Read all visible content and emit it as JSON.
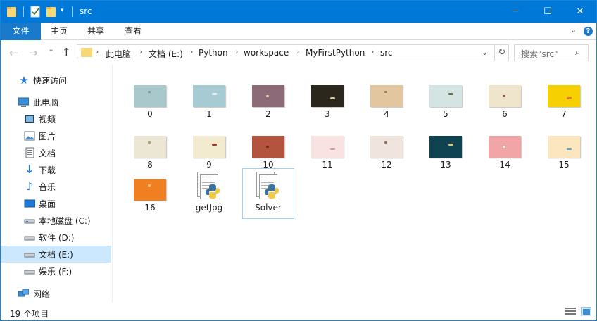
{
  "window": {
    "title": "src",
    "accent": "#0078d7",
    "controls": {
      "minimize": "─",
      "maximize": "☐",
      "close": "✕"
    }
  },
  "ribbon": {
    "tabs": [
      "文件",
      "主页",
      "共享",
      "查看"
    ],
    "collapse_icon": "chevron-down-icon",
    "help_label": "?"
  },
  "address": {
    "back": "←",
    "forward": "→",
    "recent": "⌄",
    "up": "↑",
    "crumbs": [
      "此电脑",
      "文档 (E:)",
      "Python",
      "workspace",
      "MyFirstPython",
      "src"
    ],
    "separator": "›",
    "dropdown": "⌄",
    "refresh": "↻"
  },
  "search": {
    "placeholder": "搜索\"src\"",
    "icon": "⌕"
  },
  "nav": {
    "quick_access": "快速访问",
    "this_pc": "此电脑",
    "items": [
      {
        "label": "视频",
        "icon": "video-icon"
      },
      {
        "label": "图片",
        "icon": "picture-icon"
      },
      {
        "label": "文档",
        "icon": "document-icon"
      },
      {
        "label": "下载",
        "icon": "download-icon"
      },
      {
        "label": "音乐",
        "icon": "music-icon"
      },
      {
        "label": "桌面",
        "icon": "desktop-icon"
      },
      {
        "label": "本地磁盘 (C:)",
        "icon": "drive-icon"
      },
      {
        "label": "软件 (D:)",
        "icon": "drive-icon"
      },
      {
        "label": "文档 (E:)",
        "icon": "drive-icon"
      },
      {
        "label": "娱乐 (F:)",
        "icon": "drive-icon"
      }
    ],
    "network": "网络",
    "selected": "文档 (E:)"
  },
  "files": [
    {
      "name": "0",
      "bg": "#a9c8cb",
      "dot": "#6f8f93"
    },
    {
      "name": "1",
      "bg": "#a7cbd3",
      "dot": "#f2f2f2"
    },
    {
      "name": "2",
      "bg": "#8d6a78",
      "dot": "#f3d7a2"
    },
    {
      "name": "3",
      "bg": "#2c271d",
      "dot": "#d9c9a3"
    },
    {
      "name": "4",
      "bg": "#e1c6a0",
      "dot": "#9a7b57"
    },
    {
      "name": "5",
      "bg": "#d3e4e2",
      "dot": "#6e6a4a"
    },
    {
      "name": "6",
      "bg": "#efe4cc",
      "dot": "#8a5a3a"
    },
    {
      "name": "7",
      "bg": "#f7d000",
      "dot": "#e07a2e"
    },
    {
      "name": "8",
      "bg": "#ece6d4",
      "dot": "#b29b6f"
    },
    {
      "name": "9",
      "bg": "#f3ebd0",
      "dot": "#b02a25"
    },
    {
      "name": "10",
      "bg": "#b3543f",
      "dot": "#6b2a1f"
    },
    {
      "name": "11",
      "bg": "#f8e2e2",
      "dot": "#c9a0a0"
    },
    {
      "name": "12",
      "bg": "#efe5de",
      "dot": "#9a6f5a"
    },
    {
      "name": "13",
      "bg": "#0f4352",
      "dot": "#e5c36d"
    },
    {
      "name": "14",
      "bg": "#f2a5a6",
      "dot": "#fff4ee"
    },
    {
      "name": "15",
      "bg": "#fbe6bf",
      "dot": "#6f9fb8"
    },
    {
      "name": "16",
      "bg": "#ef7f21",
      "dot": "#f6c79a"
    },
    {
      "name": "getJpg",
      "type": "py"
    },
    {
      "name": "Solver",
      "type": "py",
      "selected": true
    }
  ],
  "status": {
    "count_text": "19 个项目",
    "view_icons": [
      "details-view-icon",
      "large-icons-view-icon"
    ]
  }
}
